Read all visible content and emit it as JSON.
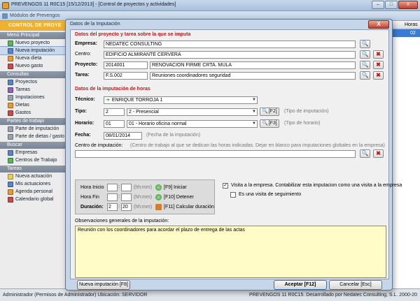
{
  "main_window": {
    "title": "PREVENGOS 11 R0C15 [15/12/2013] - [Control de proyectos y actividades]",
    "buttons": {
      "minimize": "–",
      "maximize": "□",
      "close": "X"
    }
  },
  "mdi_window": {
    "title": "Módulos de Prevengos"
  },
  "sidebar": {
    "header": "CONTROL DE PROYE",
    "sections": [
      {
        "title": "Menú Principal",
        "items": [
          "Nuevo proyecto",
          "Nueva imputación",
          "Nueva dieta",
          "Nuevo gasto"
        ]
      },
      {
        "title": "Consultas",
        "items": [
          "Proyectos",
          "Tareas",
          "Imputaciones",
          "Dietas",
          "Gastos"
        ]
      },
      {
        "title": "Partes de trabajo",
        "items": [
          "Parte de imputación",
          "Parte de dietas / gasto"
        ]
      },
      {
        "title": "Buscar",
        "items": [
          "Empresas",
          "Centros de Trabajo"
        ]
      },
      {
        "title": "Tareas",
        "items": [
          "Nueva actuación",
          "Mis actuaciones",
          "Agenda personal",
          "Calendario global"
        ]
      }
    ]
  },
  "right_grid": {
    "header": "Horas",
    "row_value": "02"
  },
  "statusbar": {
    "left": "Administrador    (Permisos de Administrador)    Ubicación: SERVIDOR",
    "right": "PREVENGOS 11 R0C15. Desarrollado por Nedatec Consulting, S.L. 2000-20"
  },
  "dialog": {
    "title": "Datos de la Imputación",
    "close_label": "X",
    "project_section": {
      "title": "Datos del proyecto y tarea sobre la que se imputa",
      "empresa_label": "Empresa:",
      "empresa_value": "NEDATEC CONSULTING",
      "centro_label": "Centro:",
      "centro_value": "EDIFICIO ALMIRANTE CERVERA",
      "proyecto_label": "Proyecto:",
      "proyecto_code": "2014001",
      "proyecto_name": "RENOVACION FIRME CRTA. MULA",
      "tarea_label": "Tarea:",
      "tarea_code": "F.S.002",
      "tarea_name": "Reuniones coordinadores seguridad"
    },
    "hours_section": {
      "title": "Datos de la imputación de horas",
      "tecnico_label": "Técnico:",
      "tecnico_value": "ENRIQUE TORROJA 1",
      "tipo_label": "Tipo:",
      "tipo_code": "2",
      "tipo_value": "2 - Presencial",
      "tipo_key": "[F2]",
      "tipo_hint": "(Tipo de imputación)",
      "horario_label": "Horario:",
      "horario_code": "01",
      "horario_value": "01 - Horario oficina normal",
      "horario_key": "[F3]",
      "horario_hint": "(Tipo de horario)",
      "fecha_label": "Fecha:",
      "fecha_value": "08/01/2014",
      "fecha_hint": "(Fecha de la imputación)",
      "centro_imp_label": "Centro de imputación:",
      "centro_imp_hint": "(Centro de trabajo al que se dedican las horas indicadas. Dejar en blanco para imputaciones globales en la empresa)",
      "centro_imp_value": ""
    },
    "time": {
      "inicio_label": "Hora Inicio",
      "fin_label": "Hora Fin",
      "duracion_label": "Duración:",
      "format_hint": "(hh:mm)",
      "inicio_h": "",
      "inicio_m": "",
      "fin_h": "",
      "fin_m": "",
      "duracion_h": "2",
      "duracion_m": "20",
      "iniciar_label": "[F9] Iniciar",
      "detener_label": "[F10] Detener",
      "calcular_label": "[F11] Calcular duración"
    },
    "visita_label": "Visita a la empresa. Contabilizar esta imputacion como una visita a la empresa",
    "visita_checked": true,
    "seguimiento_label": "Es una visita de seguimiento",
    "seguimiento_checked": false,
    "observaciones_label": "Observaciones generales de la imputación:",
    "observaciones_value": "Reunión con los coordinadores para acordar el plazo de entrega de las actas",
    "footer": {
      "nueva_label": "Nueva imputación [F8]",
      "aceptar_label": "Aceptar [F12]",
      "cancelar_label": "Cancelar [Esc]"
    }
  },
  "colors": {
    "section_red": "#c0181c",
    "obs_yellow": "#fffcc8",
    "selection_blue": "#3a7bd5"
  }
}
